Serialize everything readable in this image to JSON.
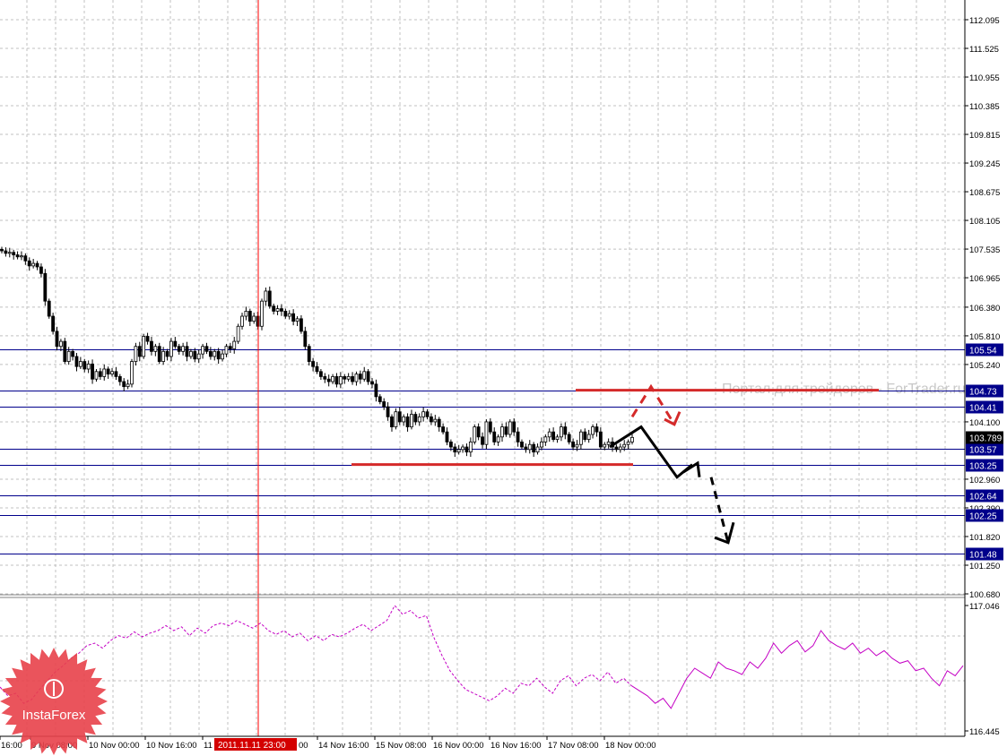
{
  "chart_data": [
    {
      "type": "candlestick",
      "title": "",
      "ylim": [
        100.68,
        112.095
      ],
      "y_ticks": [
        "112.095",
        "111.525",
        "110.955",
        "110.385",
        "109.815",
        "109.245",
        "108.675",
        "108.105",
        "107.535",
        "106.965",
        "106.380",
        "105.810",
        "105.240",
        "104.100",
        "102.960",
        "102.390",
        "101.820",
        "101.250",
        "100.680"
      ],
      "x_ticks": [
        "16:00",
        "9 Nov 08:00",
        "10 Nov 00:00",
        "10 Nov 16:00",
        "11",
        "14 Nov 16:00",
        "15 Nov 08:00",
        "16 Nov 00:00",
        "16 Nov 16:00",
        "17 Nov 08:00",
        "18 Nov 00:00"
      ],
      "x_ticks_after_marker": [
        "00"
      ],
      "crosshair_label": "2011.11.11 23:00",
      "current_price": {
        "label": "103.789",
        "value": 103.789
      },
      "levels": [
        {
          "label": "105.54",
          "value": 105.54
        },
        {
          "label": "104.73",
          "value": 104.73
        },
        {
          "label": "104.41",
          "value": 104.41
        },
        {
          "label": "103.57",
          "value": 103.57
        },
        {
          "label": "103.25",
          "value": 103.25
        },
        {
          "label": "102.64",
          "value": 102.64
        },
        {
          "label": "102.25",
          "value": 102.25
        },
        {
          "label": "101.48",
          "value": 101.48
        }
      ],
      "closes": [
        107.5,
        107.45,
        107.47,
        107.42,
        107.38,
        107.4,
        107.3,
        107.2,
        107.25,
        107.18,
        107.05,
        106.5,
        106.2,
        105.9,
        105.6,
        105.7,
        105.3,
        105.5,
        105.4,
        105.2,
        105.3,
        105.15,
        105.25,
        104.95,
        105.1,
        105.0,
        105.15,
        105.05,
        105.1,
        105.0,
        104.9,
        104.8,
        104.85,
        105.3,
        105.6,
        105.4,
        105.8,
        105.7,
        105.5,
        105.6,
        105.3,
        105.5,
        105.4,
        105.7,
        105.6,
        105.5,
        105.6,
        105.4,
        105.5,
        105.35,
        105.45,
        105.6,
        105.5,
        105.4,
        105.5,
        105.35,
        105.45,
        105.6,
        105.55,
        105.7,
        106.0,
        106.2,
        106.3,
        106.1,
        106.2,
        106.0,
        106.5,
        106.7,
        106.4,
        106.3,
        106.35,
        106.3,
        106.2,
        106.25,
        106.1,
        106.15,
        105.9,
        105.6,
        105.3,
        105.2,
        105.1,
        105.0,
        104.95,
        104.9,
        105.0,
        104.85,
        105.0,
        104.95,
        105.0,
        104.9,
        105.05,
        104.95,
        105.1,
        104.9,
        104.85,
        104.6,
        104.5,
        104.4,
        104.2,
        104.0,
        104.3,
        104.1,
        104.2,
        104.0,
        104.25,
        104.1,
        104.2,
        104.3,
        104.2,
        104.1,
        104.15,
        104.0,
        103.9,
        103.7,
        103.6,
        103.5,
        103.55,
        103.6,
        103.5,
        103.7,
        104.0,
        103.8,
        103.65,
        104.1,
        103.9,
        103.7,
        103.8,
        104.0,
        103.85,
        104.1,
        103.9,
        103.7,
        103.6,
        103.55,
        103.65,
        103.5,
        103.6,
        103.7,
        103.8,
        103.9,
        103.75,
        103.8,
        104.0,
        103.85,
        103.7,
        103.6,
        103.65,
        103.9,
        103.75,
        103.85,
        104.0,
        103.9,
        103.6,
        103.65,
        103.7,
        103.6,
        103.55,
        103.6,
        103.65,
        103.7,
        103.79
      ],
      "forecast_solid": [
        104.0,
        103.0,
        103.25
      ],
      "forecast_dashed": [
        103.0,
        101.7
      ],
      "forecast_red_dashed": [
        104.8,
        104.05
      ],
      "red_lines": [
        104.73,
        103.25
      ]
    },
    {
      "type": "line",
      "title": "",
      "ylim": [
        116.445,
        117.046
      ],
      "y_ticks": [
        "117.046",
        "116.445"
      ],
      "values": [
        0.35,
        0.28,
        0.3,
        0.22,
        0.25,
        0.33,
        0.4,
        0.47,
        0.52,
        0.58,
        0.62,
        0.68,
        0.7,
        0.66,
        0.72,
        0.76,
        0.74,
        0.79,
        0.75,
        0.78,
        0.8,
        0.84,
        0.8,
        0.83,
        0.76,
        0.82,
        0.78,
        0.84,
        0.86,
        0.84,
        0.88,
        0.85,
        0.82,
        0.86,
        0.8,
        0.77,
        0.8,
        0.75,
        0.78,
        0.72,
        0.76,
        0.72,
        0.77,
        0.75,
        0.78,
        0.82,
        0.85,
        0.8,
        0.84,
        0.88,
        1.0,
        0.93,
        0.96,
        0.9,
        0.92,
        0.74,
        0.6,
        0.48,
        0.4,
        0.33,
        0.3,
        0.27,
        0.24,
        0.28,
        0.34,
        0.3,
        0.38,
        0.36,
        0.42,
        0.35,
        0.3,
        0.4,
        0.44,
        0.36,
        0.42,
        0.45,
        0.4,
        0.47,
        0.38,
        0.42,
        0.36,
        0.32,
        0.28,
        0.22,
        0.26,
        0.18,
        0.3,
        0.42,
        0.5,
        0.46,
        0.42,
        0.55,
        0.5,
        0.48,
        0.45,
        0.55,
        0.5,
        0.58,
        0.7,
        0.62,
        0.68,
        0.72,
        0.63,
        0.68,
        0.8,
        0.72,
        0.68,
        0.65,
        0.7,
        0.62,
        0.66,
        0.6,
        0.64,
        0.58,
        0.54,
        0.56,
        0.48,
        0.5,
        0.42,
        0.36,
        0.48,
        0.44,
        0.52
      ],
      "dashed_until_index": 80
    }
  ],
  "watermark": "Портал для трейдеров - ForTrader.ru",
  "logo": {
    "text": "InstaForex",
    "color": "#e8414a"
  },
  "colors": {
    "level_line": "#00008b",
    "level_box": "#00008b",
    "crosshair": "#ff0000",
    "red_level": "#d42a2a",
    "indicator": "#c400c4",
    "grid": "#c0c0c0"
  }
}
